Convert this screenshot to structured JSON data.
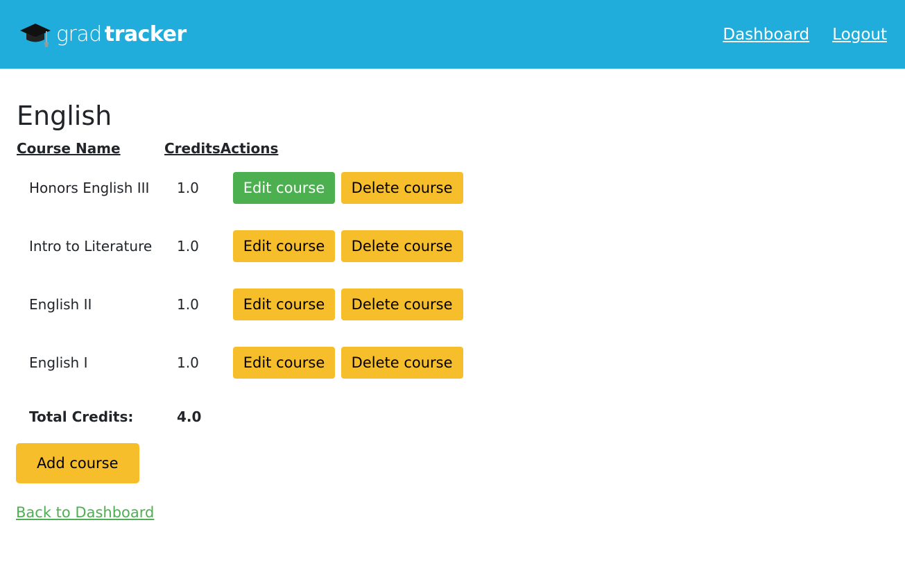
{
  "header": {
    "brand_part1": "grad",
    "brand_part2": "tracker",
    "nav": [
      "Dashboard",
      "Logout"
    ]
  },
  "page_title": "English",
  "table": {
    "headers": [
      "Course Name",
      "Credits",
      "Actions"
    ],
    "rows": [
      {
        "name": "Honors English III",
        "credits": "1.0",
        "edit": "Edit course",
        "delete": "Delete course"
      },
      {
        "name": "Intro to Literature",
        "credits": "1.0",
        "edit": "Edit course",
        "delete": "Delete course"
      },
      {
        "name": "English II",
        "credits": "1.0",
        "edit": "Edit course",
        "delete": "Delete course"
      },
      {
        "name": "English I",
        "credits": "1.0",
        "edit": "Edit course",
        "delete": "Delete course"
      }
    ],
    "total_label": "Total Credits:",
    "total_value": "4.0"
  },
  "add_course_label": "Add course",
  "back_link": "Back to Dashboard",
  "colors": {
    "header_bg": "#21addc",
    "accent_yellow": "#f7be2c",
    "accent_green": "#4caf50"
  }
}
